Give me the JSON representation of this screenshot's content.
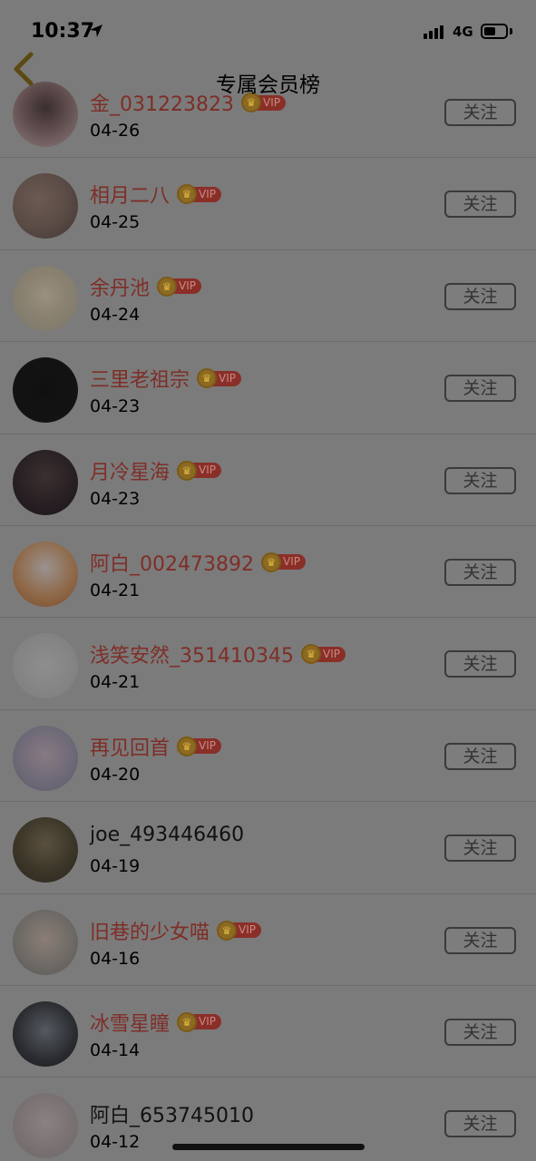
{
  "status_bar": {
    "time": "10:37",
    "network": "4G"
  },
  "header": {
    "title": "专属会员榜"
  },
  "vip_badge_text": "VIP",
  "follow_label": "关注",
  "colors": {
    "vip_name": "#7e2e27",
    "overlay": "#7b7b7b"
  },
  "rows": [
    {
      "name": "金_031223823",
      "date": "04-26",
      "vip": true
    },
    {
      "name": "相月二八",
      "date": "04-25",
      "vip": true
    },
    {
      "name": "余丹池",
      "date": "04-24",
      "vip": true
    },
    {
      "name": "三里老祖宗",
      "date": "04-23",
      "vip": true
    },
    {
      "name": "月冷星海",
      "date": "04-23",
      "vip": true
    },
    {
      "name": "阿白_002473892",
      "date": "04-21",
      "vip": true
    },
    {
      "name": "浅笑安然_351410345",
      "date": "04-21",
      "vip": true
    },
    {
      "name": "再见回首",
      "date": "04-20",
      "vip": true
    },
    {
      "name": "joe_493446460",
      "date": "04-19",
      "vip": false
    },
    {
      "name": "旧巷的少女喵",
      "date": "04-16",
      "vip": true
    },
    {
      "name": "冰雪星瞳",
      "date": "04-14",
      "vip": true
    },
    {
      "name": "阿白_653745010",
      "date": "04-12",
      "vip": false
    }
  ]
}
